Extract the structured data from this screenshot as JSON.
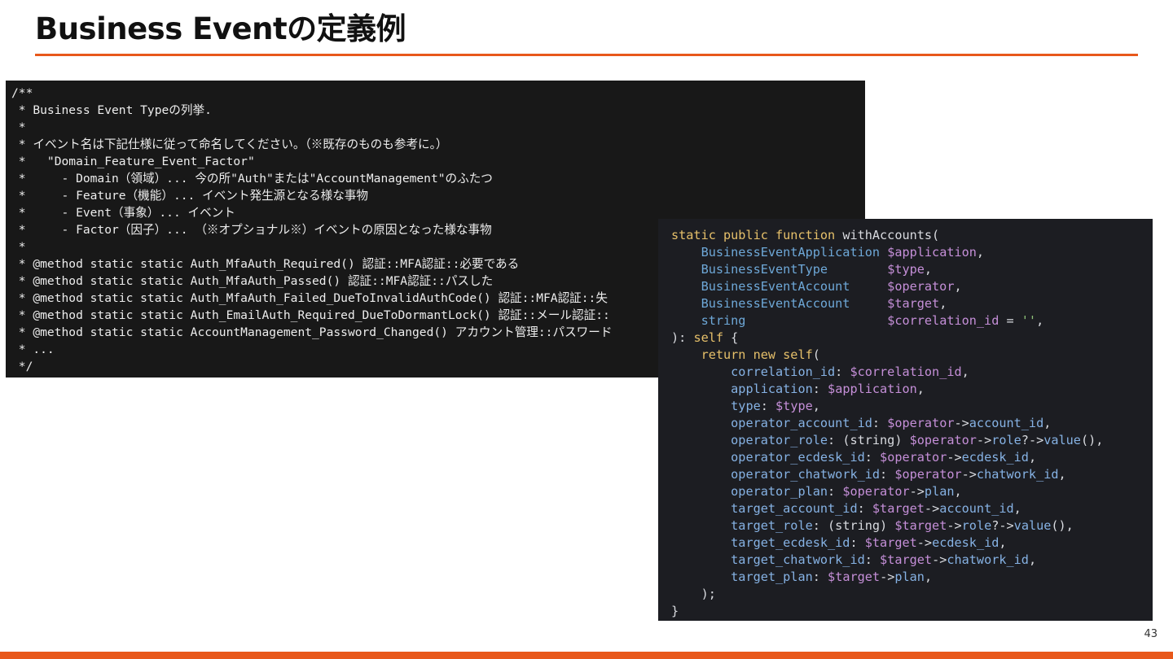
{
  "slide": {
    "title": "Business Eventの定義例",
    "page_number": "43",
    "accent_color": "#e8581b"
  },
  "comment_block": {
    "lines": [
      "/**",
      " * Business Event Typeの列挙.",
      " *",
      " * イベント名は下記仕様に従って命名してください。（※既存のものも参考に。）",
      " *   \"Domain_Feature_Event_Factor\"",
      " *     - Domain（領域）... 今の所\"Auth\"または\"AccountManagement\"のふたつ",
      " *     - Feature（機能）... イベント発生源となる様な事物",
      " *     - Event（事象）... イベント",
      " *     - Factor（因子）... （※オプショナル※）イベントの原因となった様な事物",
      " *",
      " * @method static static Auth_MfaAuth_Required() 認証::MFA認証::必要である",
      " * @method static static Auth_MfaAuth_Passed() 認証::MFA認証::パスした",
      " * @method static static Auth_MfaAuth_Failed_DueToInvalidAuthCode() 認証::MFA認証::失",
      " * @method static static Auth_EmailAuth_Required_DueToDormantLock() 認証::メール認証::",
      " * @method static static AccountManagement_Password_Changed() アカウント管理::パスワード",
      " * ...",
      " */"
    ]
  },
  "function_block": {
    "colors": {
      "keyword": "#e6c06a",
      "type": "#6ea8d8",
      "variable": "#c58fd8",
      "string": "#8fc27a",
      "property": "#86b2e4",
      "plain": "#d9dbe0"
    },
    "lines": [
      [
        [
          "kw",
          "static public function "
        ],
        [
          "plain",
          "withAccounts("
        ]
      ],
      [
        [
          "plain",
          "    "
        ],
        [
          "type",
          "BusinessEventApplication"
        ],
        [
          "plain",
          " "
        ],
        [
          "var",
          "$application"
        ],
        [
          "plain",
          ","
        ]
      ],
      [
        [
          "plain",
          "    "
        ],
        [
          "type",
          "BusinessEventType"
        ],
        [
          "plain",
          "        "
        ],
        [
          "var",
          "$type"
        ],
        [
          "plain",
          ","
        ]
      ],
      [
        [
          "plain",
          "    "
        ],
        [
          "type",
          "BusinessEventAccount"
        ],
        [
          "plain",
          "     "
        ],
        [
          "var",
          "$operator"
        ],
        [
          "plain",
          ","
        ]
      ],
      [
        [
          "plain",
          "    "
        ],
        [
          "type",
          "BusinessEventAccount"
        ],
        [
          "plain",
          "     "
        ],
        [
          "var",
          "$target"
        ],
        [
          "plain",
          ","
        ]
      ],
      [
        [
          "plain",
          "    "
        ],
        [
          "type",
          "string"
        ],
        [
          "plain",
          "                   "
        ],
        [
          "var",
          "$correlation_id"
        ],
        [
          "plain",
          " = "
        ],
        [
          "str",
          "''"
        ],
        [
          "plain",
          ","
        ]
      ],
      [
        [
          "plain",
          "): "
        ],
        [
          "kw",
          "self"
        ],
        [
          "plain",
          " {"
        ]
      ],
      [
        [
          "plain",
          "    "
        ],
        [
          "kw",
          "return new self"
        ],
        [
          "plain",
          "("
        ]
      ],
      [
        [
          "plain",
          "        "
        ],
        [
          "prop",
          "correlation_id"
        ],
        [
          "plain",
          ": "
        ],
        [
          "var",
          "$correlation_id"
        ],
        [
          "plain",
          ","
        ]
      ],
      [
        [
          "plain",
          "        "
        ],
        [
          "prop",
          "application"
        ],
        [
          "plain",
          ": "
        ],
        [
          "var",
          "$application"
        ],
        [
          "plain",
          ","
        ]
      ],
      [
        [
          "plain",
          "        "
        ],
        [
          "prop",
          "type"
        ],
        [
          "plain",
          ": "
        ],
        [
          "var",
          "$type"
        ],
        [
          "plain",
          ","
        ]
      ],
      [
        [
          "plain",
          "        "
        ],
        [
          "prop",
          "operator_account_id"
        ],
        [
          "plain",
          ": "
        ],
        [
          "var",
          "$operator"
        ],
        [
          "plain",
          "->"
        ],
        [
          "prop",
          "account_id"
        ],
        [
          "plain",
          ","
        ]
      ],
      [
        [
          "plain",
          "        "
        ],
        [
          "prop",
          "operator_role"
        ],
        [
          "plain",
          ": (string) "
        ],
        [
          "var",
          "$operator"
        ],
        [
          "plain",
          "->"
        ],
        [
          "prop",
          "role"
        ],
        [
          "plain",
          "?->"
        ],
        [
          "prop",
          "value"
        ],
        [
          "plain",
          "(),"
        ]
      ],
      [
        [
          "plain",
          "        "
        ],
        [
          "prop",
          "operator_ecdesk_id"
        ],
        [
          "plain",
          ": "
        ],
        [
          "var",
          "$operator"
        ],
        [
          "plain",
          "->"
        ],
        [
          "prop",
          "ecdesk_id"
        ],
        [
          "plain",
          ","
        ]
      ],
      [
        [
          "plain",
          "        "
        ],
        [
          "prop",
          "operator_chatwork_id"
        ],
        [
          "plain",
          ": "
        ],
        [
          "var",
          "$operator"
        ],
        [
          "plain",
          "->"
        ],
        [
          "prop",
          "chatwork_id"
        ],
        [
          "plain",
          ","
        ]
      ],
      [
        [
          "plain",
          "        "
        ],
        [
          "prop",
          "operator_plan"
        ],
        [
          "plain",
          ": "
        ],
        [
          "var",
          "$operator"
        ],
        [
          "plain",
          "->"
        ],
        [
          "prop",
          "plan"
        ],
        [
          "plain",
          ","
        ]
      ],
      [
        [
          "plain",
          "        "
        ],
        [
          "prop",
          "target_account_id"
        ],
        [
          "plain",
          ": "
        ],
        [
          "var",
          "$target"
        ],
        [
          "plain",
          "->"
        ],
        [
          "prop",
          "account_id"
        ],
        [
          "plain",
          ","
        ]
      ],
      [
        [
          "plain",
          "        "
        ],
        [
          "prop",
          "target_role"
        ],
        [
          "plain",
          ": (string) "
        ],
        [
          "var",
          "$target"
        ],
        [
          "plain",
          "->"
        ],
        [
          "prop",
          "role"
        ],
        [
          "plain",
          "?->"
        ],
        [
          "prop",
          "value"
        ],
        [
          "plain",
          "(),"
        ]
      ],
      [
        [
          "plain",
          "        "
        ],
        [
          "prop",
          "target_ecdesk_id"
        ],
        [
          "plain",
          ": "
        ],
        [
          "var",
          "$target"
        ],
        [
          "plain",
          "->"
        ],
        [
          "prop",
          "ecdesk_id"
        ],
        [
          "plain",
          ","
        ]
      ],
      [
        [
          "plain",
          "        "
        ],
        [
          "prop",
          "target_chatwork_id"
        ],
        [
          "plain",
          ": "
        ],
        [
          "var",
          "$target"
        ],
        [
          "plain",
          "->"
        ],
        [
          "prop",
          "chatwork_id"
        ],
        [
          "plain",
          ","
        ]
      ],
      [
        [
          "plain",
          "        "
        ],
        [
          "prop",
          "target_plan"
        ],
        [
          "plain",
          ": "
        ],
        [
          "var",
          "$target"
        ],
        [
          "plain",
          "->"
        ],
        [
          "prop",
          "plan"
        ],
        [
          "plain",
          ","
        ]
      ],
      [
        [
          "plain",
          "    );"
        ]
      ],
      [
        [
          "plain",
          "}"
        ]
      ]
    ]
  }
}
